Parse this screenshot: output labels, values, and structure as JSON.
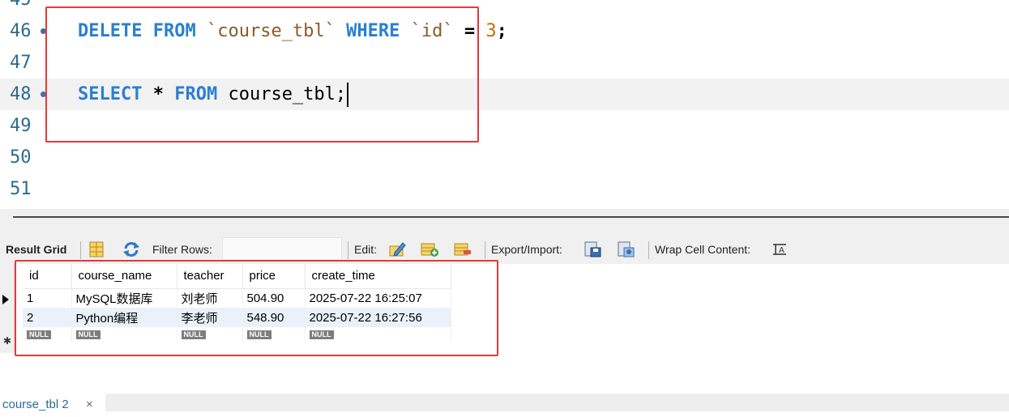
{
  "editor": {
    "partial_line_number": "45",
    "lines": [
      {
        "num": "46",
        "tokens": [
          {
            "t": "DELETE",
            "c": "kw"
          },
          {
            "t": " ",
            "c": ""
          },
          {
            "t": "FROM",
            "c": "kw"
          },
          {
            "t": " ",
            "c": ""
          },
          {
            "t": "`course_tbl`",
            "c": "str"
          },
          {
            "t": " ",
            "c": ""
          },
          {
            "t": "WHERE",
            "c": "kw"
          },
          {
            "t": " ",
            "c": ""
          },
          {
            "t": "`id`",
            "c": "str"
          },
          {
            "t": " = ",
            "c": "op"
          },
          {
            "t": "3",
            "c": "num"
          },
          {
            "t": ";",
            "c": "op"
          }
        ]
      },
      {
        "num": "47",
        "tokens": []
      },
      {
        "num": "48",
        "tokens": [
          {
            "t": "SELECT",
            "c": "kw"
          },
          {
            "t": " * ",
            "c": "op"
          },
          {
            "t": "FROM",
            "c": "kw"
          },
          {
            "t": " course_tbl;",
            "c": ""
          }
        ]
      },
      {
        "num": "49",
        "tokens": []
      },
      {
        "num": "50",
        "tokens": []
      },
      {
        "num": "51",
        "tokens": []
      }
    ]
  },
  "toolbar": {
    "result_grid": "Result Grid",
    "filter_rows": "Filter Rows:",
    "filter_value": "",
    "edit": "Edit:",
    "export_import": "Export/Import:",
    "wrap_cell": "Wrap Cell Content:"
  },
  "grid": {
    "columns": [
      "id",
      "course_name",
      "teacher",
      "price",
      "create_time"
    ],
    "rows": [
      [
        "1",
        "MySQL数据库",
        "刘老师",
        "504.90",
        "2025-07-22 16:25:07"
      ],
      [
        "2",
        "Python编程",
        "李老师",
        "548.90",
        "2025-07-22 16:27:56"
      ]
    ],
    "null_label": "NULL"
  },
  "tabs": {
    "active": "course_tbl 2",
    "close_symbol": "×"
  },
  "colors": {
    "keyword": "#2a7fd0",
    "string": "#8a5a2b",
    "number": "#c07000",
    "annotation": "#e23b3b"
  }
}
